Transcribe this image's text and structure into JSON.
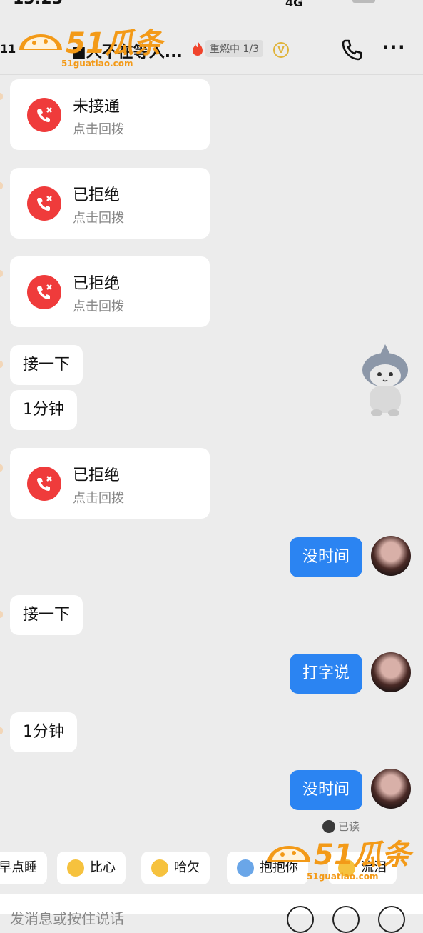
{
  "status": {
    "time": "13:23",
    "signal": "4G"
  },
  "header": {
    "back_count": "11",
    "contact_name": "■人不在等入...",
    "heat_label": "重燃中 1/3",
    "vip_badge": "V"
  },
  "watermark": {
    "brand": "51瓜条",
    "domain": "51guatiao.com"
  },
  "messages": [
    {
      "kind": "call",
      "title": "未接通",
      "action": "点击回拨"
    },
    {
      "kind": "call",
      "title": "已拒绝",
      "action": "点击回拨"
    },
    {
      "kind": "call",
      "title": "已拒绝",
      "action": "点击回拨"
    },
    {
      "kind": "text",
      "text": "接一下"
    },
    {
      "kind": "text",
      "text": "1分钟"
    },
    {
      "kind": "call",
      "title": "已拒绝",
      "action": "点击回拨"
    },
    {
      "kind": "me",
      "text": "没时间"
    },
    {
      "kind": "text",
      "text": "接一下"
    },
    {
      "kind": "me",
      "text": "打字说"
    },
    {
      "kind": "text",
      "text": "1分钟"
    },
    {
      "kind": "me",
      "text": "没时间"
    }
  ],
  "read_status": "已读",
  "quick_replies": [
    "早点睡",
    "比心",
    "哈欠",
    "抱抱你",
    "流泪"
  ],
  "input": {
    "placeholder": "发消息或按住说话"
  },
  "colors": {
    "accent": "#2b84f2",
    "missed": "#ef3b3b",
    "brand": "#f39a18"
  }
}
